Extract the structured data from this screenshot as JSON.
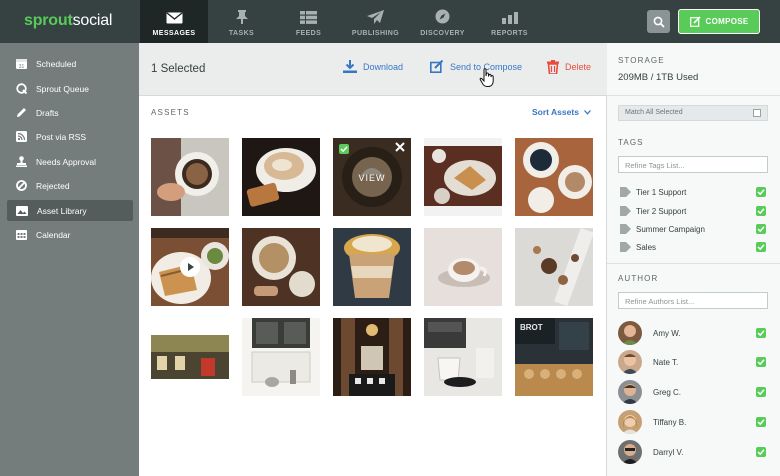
{
  "brand": {
    "part1": "sprout",
    "part2": "social"
  },
  "nav": [
    {
      "label": "MESSAGES",
      "icon": "envelope-icon",
      "active": true
    },
    {
      "label": "TASKS",
      "icon": "pin-icon"
    },
    {
      "label": "FEEDS",
      "icon": "feeds-icon"
    },
    {
      "label": "PUBLISHING",
      "icon": "paper-plane-icon"
    },
    {
      "label": "DISCOVERY",
      "icon": "compass-icon"
    },
    {
      "label": "REPORTS",
      "icon": "bar-chart-icon"
    }
  ],
  "compose_label": "COMPOSE",
  "sidebar": [
    {
      "label": "Scheduled",
      "icon": "calendar-31-icon"
    },
    {
      "label": "Sprout Queue",
      "icon": "queue-icon"
    },
    {
      "label": "Drafts",
      "icon": "pencil-icon"
    },
    {
      "label": "Post via RSS",
      "icon": "rss-icon"
    },
    {
      "label": "Needs Approval",
      "icon": "stamp-icon"
    },
    {
      "label": "Rejected",
      "icon": "ban-icon"
    },
    {
      "label": "Asset Library",
      "icon": "asset-library-icon",
      "active": true
    },
    {
      "label": "Calendar",
      "icon": "calendar-grid-icon"
    }
  ],
  "selection": {
    "count_label": "1 Selected",
    "download": "Download",
    "send": "Send to Compose",
    "delete": "Delete"
  },
  "assets": {
    "label": "ASSETS",
    "sort": "Sort Assets",
    "view_label": "VIEW"
  },
  "storage": {
    "label": "STORAGE",
    "value": "209MB / 1TB Used"
  },
  "match_all": "Match All Selected",
  "tags": {
    "label": "TAGS",
    "placeholder": "Refine Tags List...",
    "items": [
      "Tier 1 Support",
      "Tier 2 Support",
      "Summer Campaign",
      "Sales"
    ]
  },
  "author": {
    "label": "AUTHOR",
    "placeholder": "Refine Authors List...",
    "items": [
      "Amy W.",
      "Nate T.",
      "Greg C.",
      "Tiffany B.",
      "Darryl V."
    ]
  },
  "colors": {
    "topbar": "#364141",
    "sidebar": "#747c7c",
    "accent_green": "#59cb59",
    "link_blue": "#3876c4",
    "delete_red": "#e74c3c"
  }
}
